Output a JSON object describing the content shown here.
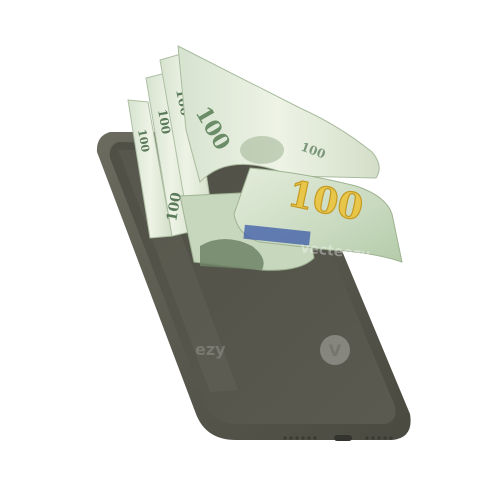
{
  "photo": {
    "subject": "smartphone-with-money",
    "phone_color": "#5e5e53",
    "bill_color": "#dfe9d8",
    "bill_denomination": "100",
    "bill_numerals": [
      "100",
      "100",
      "100",
      "100",
      "100",
      "100",
      "100"
    ],
    "numeral_color": "#e8c64a",
    "watermark_text": "vecteezy",
    "watermark_fragment": "ezy",
    "watermark_logo_glyph": "V"
  }
}
